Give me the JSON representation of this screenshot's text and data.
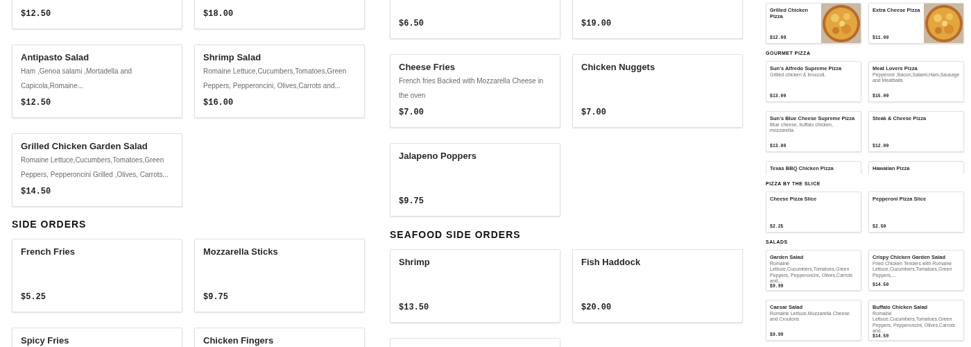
{
  "panes": [
    {
      "sections": [
        {
          "items": [
            {
              "kind": "plain",
              "price": "$12.50"
            },
            {
              "kind": "plain",
              "price": "$18.00"
            },
            {
              "kind": "plain",
              "name": "Antipasto Salad",
              "description": "Ham ,Genoa salami ,Mortadella and Capicola,Romaine...",
              "price": "$12.50"
            },
            {
              "kind": "plain",
              "name": "Shrimp Salad",
              "description": "Romaine Lettuce,Cucumbers,Tomatoes,Green Peppers, Pepperoncini, Olives,Carrots and...",
              "price": "$16.00"
            },
            {
              "kind": "plain",
              "name": "Grilled Chicken Garden Salad",
              "description": "Romaine Lettuce,Cucumbers,Tomatoes,Green Peppers, Pepperoncini Grilled ,Olives, Carrots...",
              "price": "$14.50"
            }
          ]
        },
        {
          "heading": "SIDE ORDERS",
          "items": [
            {
              "kind": "plain",
              "name": "French Fries",
              "price": "$5.25"
            },
            {
              "kind": "plain",
              "name": "Mozzarella Sticks",
              "price": "$9.75"
            },
            {
              "kind": "plain",
              "name": "Spicy Fries"
            },
            {
              "kind": "plain",
              "name": "Chicken Fingers"
            }
          ]
        }
      ]
    },
    {
      "sections": [
        {
          "items": [
            {
              "kind": "plain",
              "price": "$6.50"
            },
            {
              "kind": "plain",
              "price": "$19.00"
            },
            {
              "kind": "plain",
              "name": "Cheese Fries",
              "description": "French fries Backed with Mozzarella Cheese in the oven",
              "price": "$7.00"
            },
            {
              "kind": "plain",
              "name": "Chicken Nuggets",
              "price": "$7.00"
            },
            {
              "kind": "plain",
              "name": "Jalapeno Poppers",
              "price": "$9.75"
            }
          ]
        },
        {
          "heading": "SEAFOOD SIDE ORDERS",
          "items": [
            {
              "kind": "plain",
              "name": "Shrimp",
              "price": "$13.50"
            },
            {
              "kind": "plain",
              "name": "Fish Haddock",
              "price": "$20.00"
            },
            {
              "kind": "plain"
            }
          ]
        }
      ]
    },
    {
      "sections": [
        {
          "items": [
            {
              "kind": "picture",
              "name": "Grilled Chicken Pizza",
              "price": "$12.00"
            },
            {
              "kind": "picture",
              "name": "Extra Cheese Pizza",
              "price": "$11.00"
            }
          ]
        },
        {
          "heading": "GOURMET PIZZA",
          "items": [
            {
              "kind": "plain",
              "name": "Sun's Alfredo Supreme Pizza",
              "description": "Grilled chicken & broccoli.",
              "price": "$13.00"
            },
            {
              "kind": "plain",
              "name": "Meat Lovers Pizza",
              "description": "Pepperoni ,Bacon,Salami,Ham,Sausage and Meatballs",
              "price": "$15.00"
            },
            {
              "kind": "plain",
              "name": "Sun's Blue Cheese Supreme Pizza",
              "description": "Blue cheese, buffalo chicken, mozzarella.",
              "price": "$13.00"
            },
            {
              "kind": "plain",
              "name": "Steak & Cheese Pizza",
              "price": "$12.00"
            },
            {
              "kind": "plain",
              "name": "Texas BBQ Chicken Pizza"
            },
            {
              "kind": "plain",
              "name": "Hawaiian Pizza"
            }
          ]
        },
        {
          "heading": "PIZZA BY THE SLICE",
          "items": [
            {
              "kind": "plain",
              "name": "Cheese Pizza Slice",
              "price": "$2.25"
            },
            {
              "kind": "plain",
              "name": "Pepperoni Pizza Slice",
              "price": "$2.50"
            }
          ]
        },
        {
          "heading": "SALADS",
          "items": [
            {
              "kind": "plain",
              "name": "Garden Salad",
              "description": "Romaine Lettuce,Cucumbers,Tomatoes,Green Peppers, Pepperoncini, Olives,Carrots and...",
              "price": "$9.99"
            },
            {
              "kind": "plain",
              "name": "Crispy Chicken Garden Salad",
              "description": "Fried Chicken Tenders with Romaine Lettuce,Cucumbers,Tomatoes,Green Peppers,...",
              "price": "$14.50"
            },
            {
              "kind": "plain",
              "name": "Caesar Salad",
              "description": "Romaine Lettuce,Mozzarella Cheese and Croutons",
              "price": "$9.99"
            },
            {
              "kind": "plain",
              "name": "Buffalo Chicken Salad",
              "description": "Romaine Lettuce,Cucumbers,Tomatoes,Green Peppers, Pepperoncini, Olives,Carrots and...",
              "price": "$14.50"
            }
          ]
        }
      ]
    }
  ]
}
